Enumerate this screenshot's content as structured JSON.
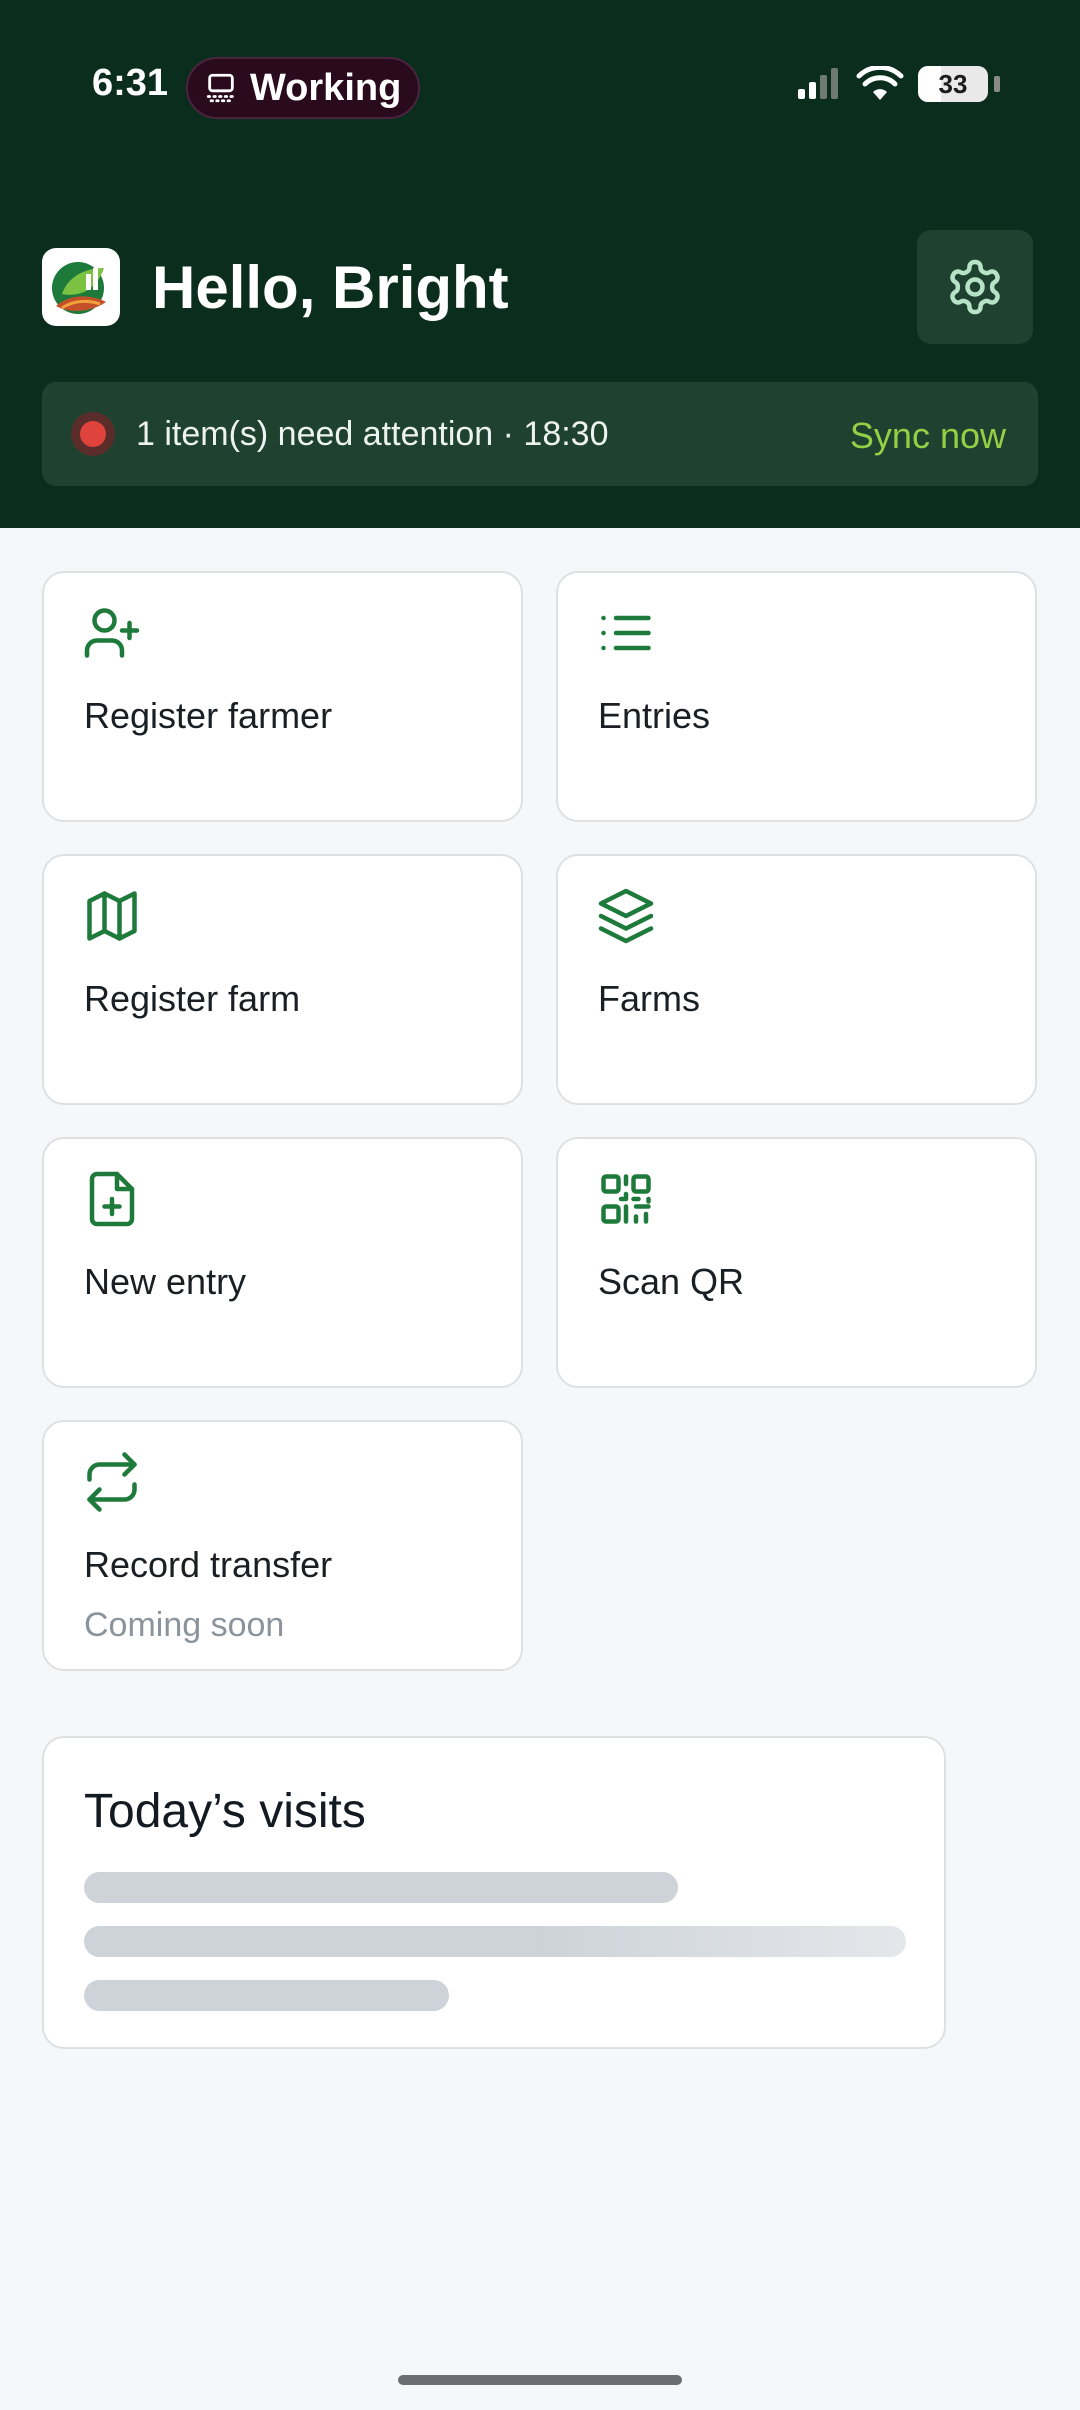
{
  "status_bar": {
    "time": "6:31",
    "activity_label": "Working",
    "battery_percent": "33",
    "battery_level": 0.33
  },
  "header": {
    "greeting": "Hello, Bright",
    "logo_icon": "farm-leaf-logo-icon",
    "settings_icon": "gear-icon"
  },
  "attention": {
    "text": "1 item(s) need attention · 18:30",
    "sync_label": "Sync now",
    "status_color": "#e0433c"
  },
  "actions": [
    {
      "label": "Register farmer",
      "icon": "user-plus-icon"
    },
    {
      "label": "Entries",
      "icon": "list-icon"
    },
    {
      "label": "Register farm",
      "icon": "map-icon"
    },
    {
      "label": "Farms",
      "icon": "layers-icon"
    },
    {
      "label": "New entry",
      "icon": "file-plus-icon"
    },
    {
      "label": "Scan QR",
      "icon": "qr-code-icon"
    },
    {
      "label": "Record transfer",
      "sublabel": "Coming soon",
      "icon": "repeat-arrows-icon"
    }
  ],
  "visits": {
    "title": "Today’s visits"
  },
  "colors": {
    "header_bg": "#0b2d1d",
    "accent_green": "#1e7a3a",
    "sync_green": "#93d046"
  }
}
